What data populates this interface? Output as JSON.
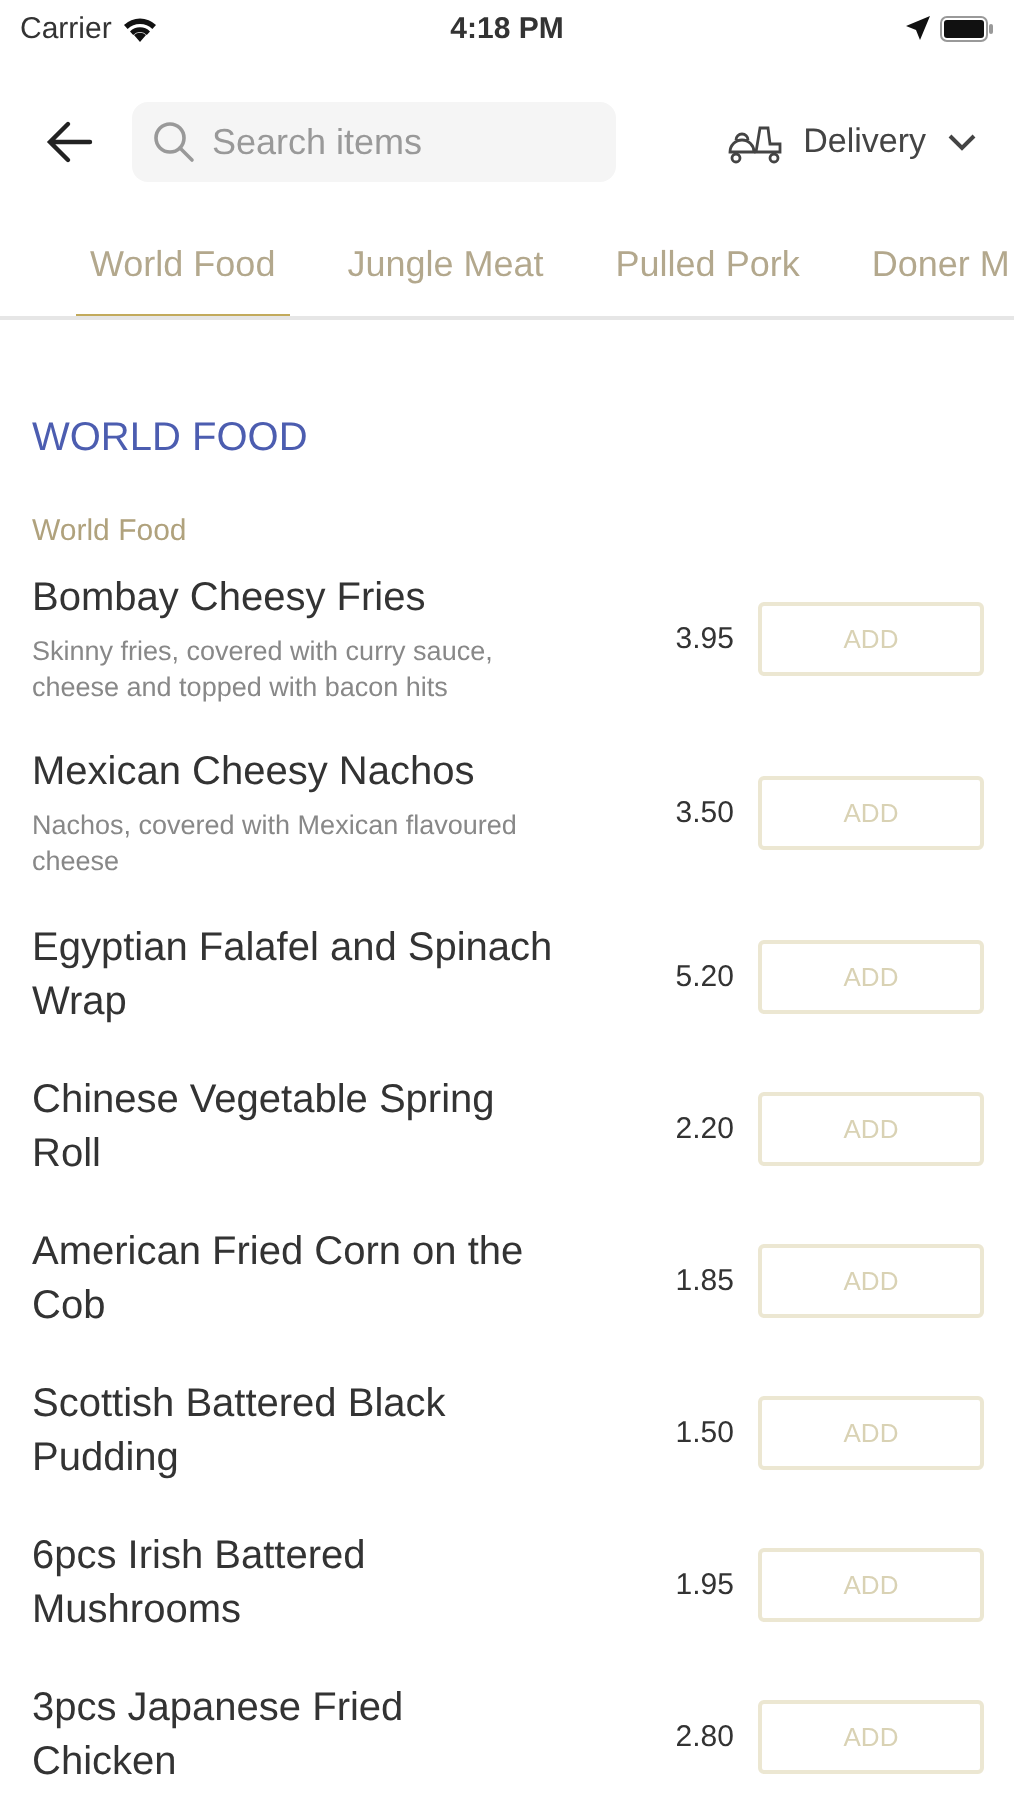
{
  "status_bar": {
    "carrier": "Carrier",
    "time": "4:18 PM"
  },
  "header": {
    "search": {
      "placeholder": "Search items"
    },
    "mode": "Delivery"
  },
  "tabs": [
    {
      "label": "World Food",
      "selected": true
    },
    {
      "label": "Jungle Meat",
      "selected": false
    },
    {
      "label": "Pulled Pork",
      "selected": false
    },
    {
      "label": "Doner M",
      "selected": false
    }
  ],
  "section": {
    "title": "WORLD FOOD",
    "subtitle": "World Food"
  },
  "items": [
    {
      "name": "Bombay Cheesy Fries",
      "description": "Skinny fries, covered with curry sauce, cheese and topped with bacon hits",
      "price": "3.95",
      "button": "ADD"
    },
    {
      "name": "Mexican Cheesy Nachos",
      "description": "Nachos, covered with Mexican flavoured cheese",
      "price": "3.50",
      "button": "ADD"
    },
    {
      "name": "Egyptian Falafel and Spinach Wrap",
      "price": "5.20",
      "button": "ADD"
    },
    {
      "name": "Chinese Vegetable Spring Roll",
      "price": "2.20",
      "button": "ADD"
    },
    {
      "name": "American Fried Corn on the Cob",
      "price": "1.85",
      "button": "ADD"
    },
    {
      "name": "Scottish Battered Black Pudding",
      "price": "1.50",
      "button": "ADD"
    },
    {
      "name": "6pcs Irish Battered Mushrooms",
      "price": "1.95",
      "button": "ADD"
    },
    {
      "name": "3pcs Japanese Fried Chicken",
      "price": "2.80",
      "button": "ADD"
    }
  ]
}
